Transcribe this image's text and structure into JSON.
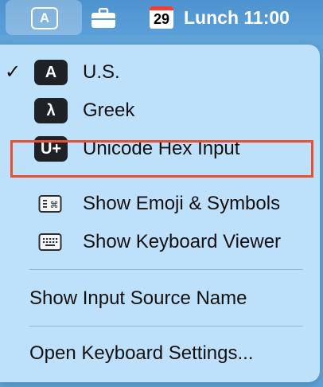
{
  "menubar": {
    "input_source_badge": "A",
    "calendar_day": "29",
    "clock_text": "Lunch 11:00"
  },
  "menu": {
    "sources": [
      {
        "badge": "A",
        "label": "U.S.",
        "checked": true,
        "check": "✓"
      },
      {
        "badge": "λ",
        "label": "Greek",
        "checked": false
      },
      {
        "badge": "U+",
        "label": "Unicode Hex Input",
        "checked": false
      }
    ],
    "show_emoji_label": "Show Emoji & Symbols",
    "show_keyboard_viewer_label": "Show Keyboard Viewer",
    "show_input_source_name_label": "Show Input Source Name",
    "open_keyboard_settings_label": "Open Keyboard Settings..."
  },
  "colors": {
    "menubar": "#5a9fd8",
    "menu_background": "#bde1fa",
    "badge_background": "#1e2226",
    "highlight_border": "#ef4d2a"
  },
  "icons": {
    "emoji_symbols": "emoji-symbols-icon",
    "keyboard_viewer": "keyboard-viewer-icon",
    "briefcase": "briefcase-icon",
    "calendar": "calendar-icon"
  }
}
